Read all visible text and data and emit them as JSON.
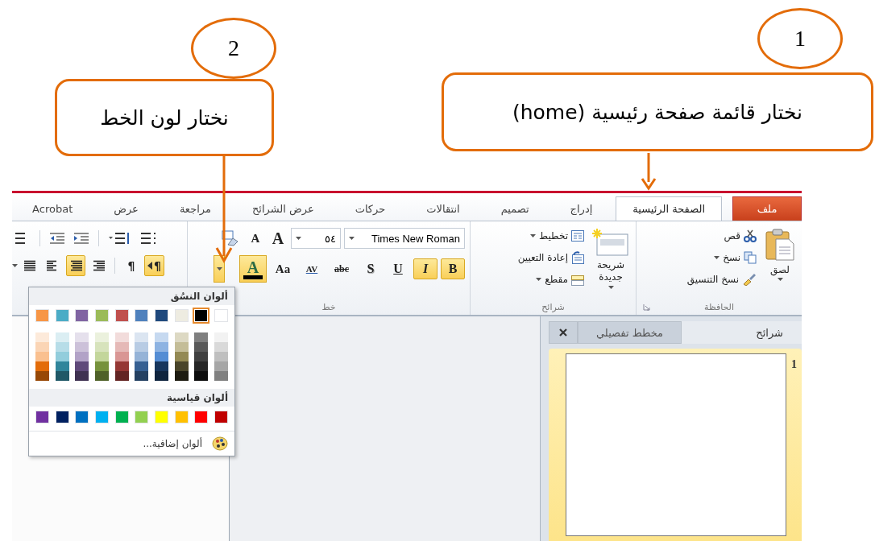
{
  "annotations": [
    {
      "number": "1",
      "text": "نختار قائمة صفحة رئيسية (home)"
    },
    {
      "number": "2",
      "text": "نختار لون الخط"
    }
  ],
  "tabs": [
    {
      "label": "ملف",
      "kind": "file",
      "selected": false
    },
    {
      "label": "الصفحة الرئيسية",
      "kind": "tab",
      "selected": true
    },
    {
      "label": "إدراج",
      "kind": "tab",
      "selected": false
    },
    {
      "label": "تصميم",
      "kind": "tab",
      "selected": false
    },
    {
      "label": "انتقالات",
      "kind": "tab",
      "selected": false
    },
    {
      "label": "حركات",
      "kind": "tab",
      "selected": false
    },
    {
      "label": "عرض الشرائح",
      "kind": "tab",
      "selected": false
    },
    {
      "label": "مراجعة",
      "kind": "tab",
      "selected": false
    },
    {
      "label": "عرض",
      "kind": "tab",
      "selected": false
    },
    {
      "label": "Acrobat",
      "kind": "tab",
      "selected": false
    }
  ],
  "clipboard": {
    "label": "الحافظة",
    "paste": "لصق",
    "cut": "قص",
    "copy": "نسخ",
    "format_painter": "نسخ التنسيق"
  },
  "slides": {
    "label": "شرائح",
    "new_slide": "شريحة جديدة",
    "layout": "تخطيط",
    "reset": "إعادة التعيين",
    "section": "مقطع"
  },
  "font": {
    "label": "خط",
    "font_name": "Times New Roman",
    "font_size": "٥٤",
    "grow": "A",
    "shrink": "A",
    "buttons": [
      {
        "kind": "bold",
        "label": "B",
        "selected": true
      },
      {
        "kind": "italic",
        "label": "I",
        "selected": true
      },
      {
        "kind": "underline",
        "label": "U",
        "selected": false
      },
      {
        "kind": "shadow",
        "label": "S",
        "selected": false
      },
      {
        "kind": "strike",
        "label": "abc",
        "selected": false
      },
      {
        "kind": "spacing",
        "label": "AV",
        "selected": false
      },
      {
        "kind": "case",
        "label": "Aa",
        "selected": false
      }
    ],
    "font_color": {
      "label": "A",
      "color": "#000000",
      "selected": true
    }
  },
  "paragraph": {
    "align": [
      {
        "kind": "right",
        "selected": false
      },
      {
        "kind": "center",
        "selected": true
      },
      {
        "kind": "left",
        "selected": false
      },
      {
        "kind": "justify",
        "selected": false
      }
    ],
    "direction": [
      {
        "kind": "rtl",
        "label": "¶",
        "selected": true
      },
      {
        "kind": "ltr",
        "label": "¶",
        "selected": false
      }
    ]
  },
  "color_menu": {
    "theme_title": "ألوان النسُق",
    "standard_title": "ألوان قياسية",
    "more": "ألوان إضافية...",
    "theme_colors": [
      {
        "color": "#ffffff",
        "selected": false,
        "shades": [
          {
            "color": "#f2f2f2"
          },
          {
            "color": "#d9d9d9"
          },
          {
            "color": "#bfbfbf"
          },
          {
            "color": "#a6a6a6"
          },
          {
            "color": "#808080"
          }
        ]
      },
      {
        "color": "#000000",
        "selected": true,
        "shades": [
          {
            "color": "#7f7f7f"
          },
          {
            "color": "#595959"
          },
          {
            "color": "#404040"
          },
          {
            "color": "#262626"
          },
          {
            "color": "#0d0d0d"
          }
        ]
      },
      {
        "color": "#eeece1",
        "selected": false,
        "shades": [
          {
            "color": "#ddd9c3"
          },
          {
            "color": "#c4bd97"
          },
          {
            "color": "#938953"
          },
          {
            "color": "#494429"
          },
          {
            "color": "#1d1b10"
          }
        ]
      },
      {
        "color": "#1f497d",
        "selected": false,
        "shades": [
          {
            "color": "#c6d9f0"
          },
          {
            "color": "#8db3e2"
          },
          {
            "color": "#548dd4"
          },
          {
            "color": "#17365d"
          },
          {
            "color": "#0f243e"
          }
        ]
      },
      {
        "color": "#4f81bd",
        "selected": false,
        "shades": [
          {
            "color": "#dbe5f1"
          },
          {
            "color": "#b8cce4"
          },
          {
            "color": "#95b3d7"
          },
          {
            "color": "#366092"
          },
          {
            "color": "#244061"
          }
        ]
      },
      {
        "color": "#c0504d",
        "selected": false,
        "shades": [
          {
            "color": "#f2dcdb"
          },
          {
            "color": "#e5b9b7"
          },
          {
            "color": "#d99694"
          },
          {
            "color": "#953734"
          },
          {
            "color": "#632423"
          }
        ]
      },
      {
        "color": "#9bbb59",
        "selected": false,
        "shades": [
          {
            "color": "#ebf1dd"
          },
          {
            "color": "#d7e3bc"
          },
          {
            "color": "#c3d69b"
          },
          {
            "color": "#76923c"
          },
          {
            "color": "#4f6128"
          }
        ]
      },
      {
        "color": "#8064a2",
        "selected": false,
        "shades": [
          {
            "color": "#e5e0ec"
          },
          {
            "color": "#ccc1d9"
          },
          {
            "color": "#b2a2c7"
          },
          {
            "color": "#5f497a"
          },
          {
            "color": "#3f3151"
          }
        ]
      },
      {
        "color": "#4bacc6",
        "selected": false,
        "shades": [
          {
            "color": "#dbeef3"
          },
          {
            "color": "#b7dde8"
          },
          {
            "color": "#92cddc"
          },
          {
            "color": "#31859b"
          },
          {
            "color": "#205867"
          }
        ]
      },
      {
        "color": "#f79646",
        "selected": false,
        "shades": [
          {
            "color": "#fdeada"
          },
          {
            "color": "#fbd5b5"
          },
          {
            "color": "#fac08f"
          },
          {
            "color": "#e36c09"
          },
          {
            "color": "#974806"
          }
        ]
      }
    ],
    "standard_colors": [
      {
        "color": "#c00000"
      },
      {
        "color": "#ff0000"
      },
      {
        "color": "#ffc000"
      },
      {
        "color": "#ffff00"
      },
      {
        "color": "#92d050"
      },
      {
        "color": "#00b050"
      },
      {
        "color": "#00b0f0"
      },
      {
        "color": "#0070c0"
      },
      {
        "color": "#002060"
      },
      {
        "color": "#7030a0"
      }
    ]
  },
  "slide_pane": {
    "tabs": [
      {
        "label": "شرائح",
        "selected": true
      },
      {
        "label": "مخطط تفصيلي",
        "selected": false
      }
    ],
    "slides": [
      {
        "number": "1",
        "selected": true
      }
    ]
  }
}
